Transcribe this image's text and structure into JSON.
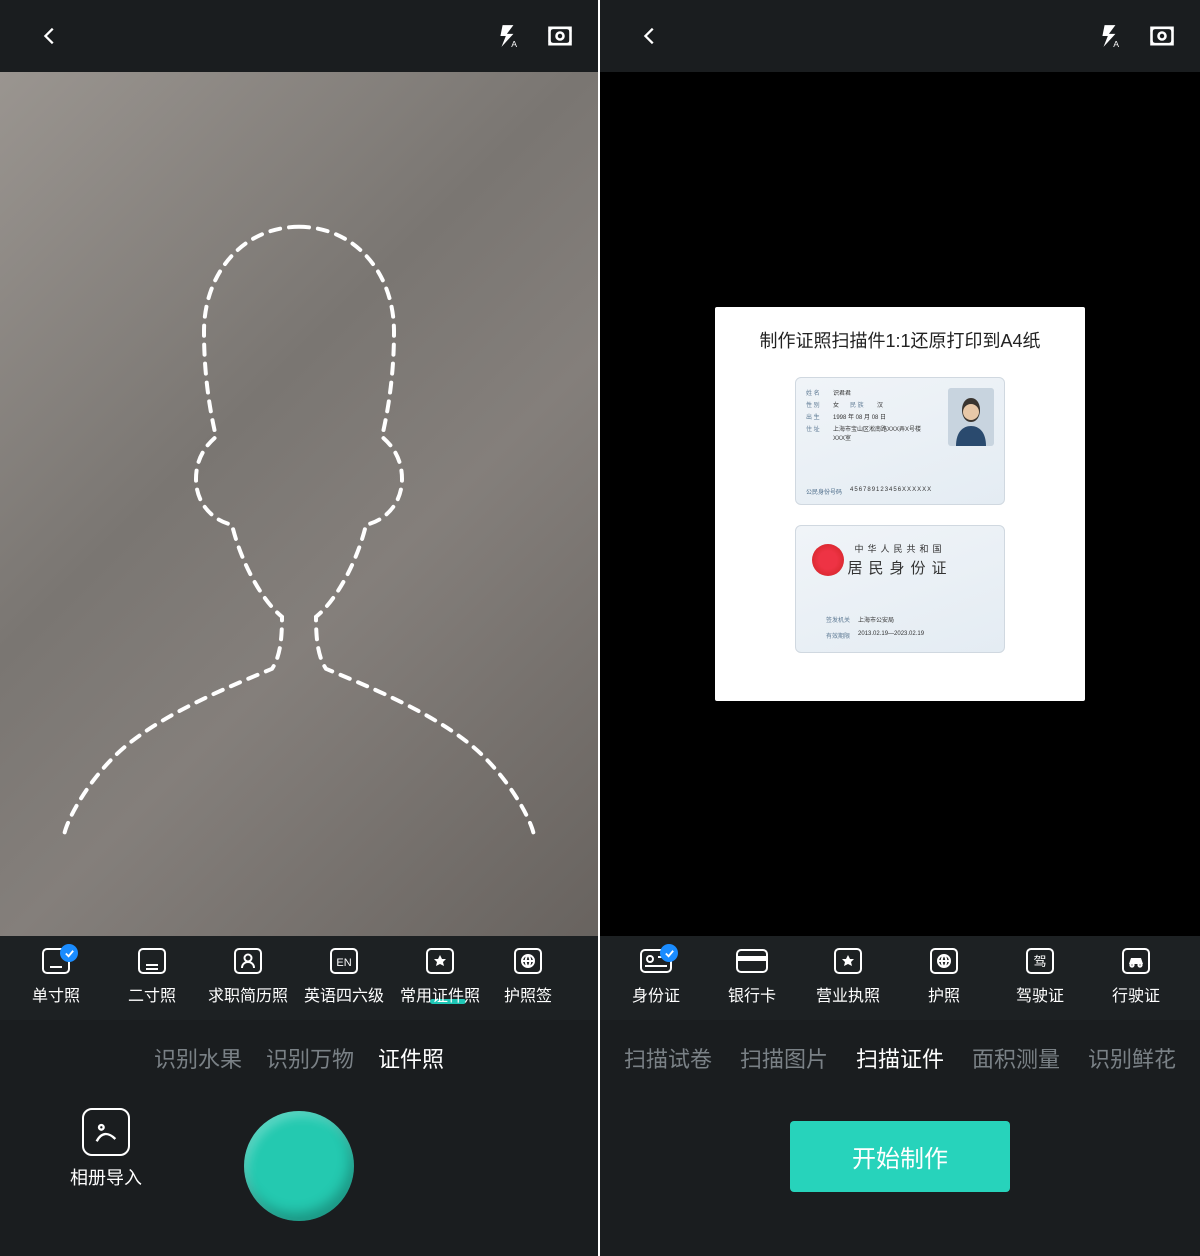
{
  "left": {
    "size_tabs": [
      {
        "label": "单寸照",
        "icon": "one-inch-icon",
        "checked": true
      },
      {
        "label": "二寸照",
        "icon": "two-inch-icon"
      },
      {
        "label": "求职简历照",
        "icon": "resume-icon",
        "indicator": true
      },
      {
        "label": "英语四六级",
        "icon": "en-exam-icon"
      },
      {
        "label": "常用证件照",
        "icon": "common-id-icon"
      },
      {
        "label": "护照签",
        "icon": "passport-icon"
      }
    ],
    "mode_tabs": [
      {
        "label": "识别水果"
      },
      {
        "label": "识别万物"
      },
      {
        "label": "证件照",
        "active": true
      }
    ],
    "gallery_label": "相册导入"
  },
  "right": {
    "panel_title": "制作证照扫描件1:1还原打印到A4纸",
    "id_front": {
      "name_label": "姓 名",
      "name": "识君君",
      "sex_label": "性 别",
      "sex": "女",
      "nation_label": "民 族",
      "nation": "汉",
      "birth_label": "出 生",
      "birth": "1998 年 08 月 08 日",
      "addr_label": "住 址",
      "addr": "上海市宝山区淞南路XXX弄X号楼 XXX室",
      "idno_label": "公民身份号码",
      "idno": "456789123456XXXXXX"
    },
    "id_back": {
      "line1": "中华人民共和国",
      "line2": "居民身份证",
      "authority_label": "签发机关",
      "authority": "上海市公安局",
      "valid_label": "有效期限",
      "valid": "2013.02.19—2023.02.19"
    },
    "size_tabs": [
      {
        "label": "身份证",
        "icon": "idcard-icon",
        "checked": true
      },
      {
        "label": "银行卡",
        "icon": "bankcard-icon"
      },
      {
        "label": "营业执照",
        "icon": "license-icon"
      },
      {
        "label": "护照",
        "icon": "passport-doc-icon",
        "indicator": true
      },
      {
        "label": "驾驶证",
        "icon": "driver-license-icon"
      },
      {
        "label": "行驶证",
        "icon": "vehicle-license-icon"
      }
    ],
    "mode_tabs": [
      {
        "label": "扫描试卷"
      },
      {
        "label": "扫描图片"
      },
      {
        "label": "扫描证件",
        "active": true
      },
      {
        "label": "面积测量"
      },
      {
        "label": "识别鲜花"
      }
    ],
    "primary_label": "开始制作"
  }
}
